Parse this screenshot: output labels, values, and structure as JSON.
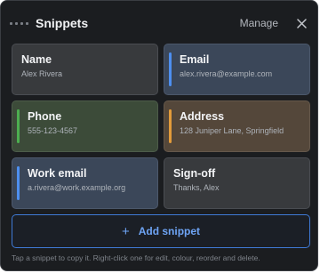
{
  "header": {
    "title": "Snippets",
    "manage_label": "Manage",
    "close_icon": "close-icon",
    "drag_icon": "drag-handle-icon"
  },
  "snippets": [
    {
      "label": "Name",
      "value": "Alex Rivera",
      "bg": "#383a3d",
      "border": "#4a4d52",
      "accent": null
    },
    {
      "label": "Email",
      "value": "alex.rivera@example.com",
      "bg": "#3b4759",
      "border": "#4c586b",
      "accent": "#4d8ff0"
    },
    {
      "label": "Phone",
      "value": "555-123-4567",
      "bg": "#3c4b39",
      "border": "#4d5c4a",
      "accent": "#4caf50"
    },
    {
      "label": "Address",
      "value": "128 Juniper Lane, Springfield",
      "bg": "#54473a",
      "border": "#65584b",
      "accent": "#e39b3a"
    },
    {
      "label": "Work email",
      "value": "a.rivera@work.example.org",
      "bg": "#3b4759",
      "border": "#4c586b",
      "accent": "#4d8ff0"
    },
    {
      "label": "Sign-off",
      "value": "Thanks, Alex",
      "bg": "#383a3d",
      "border": "#4a4d52",
      "accent": null
    }
  ],
  "add_button": {
    "icon": "plus-icon",
    "label": "Add snippet"
  },
  "hint": "Tap a snippet to copy it. Right-click one for edit, colour, reorder and delete."
}
